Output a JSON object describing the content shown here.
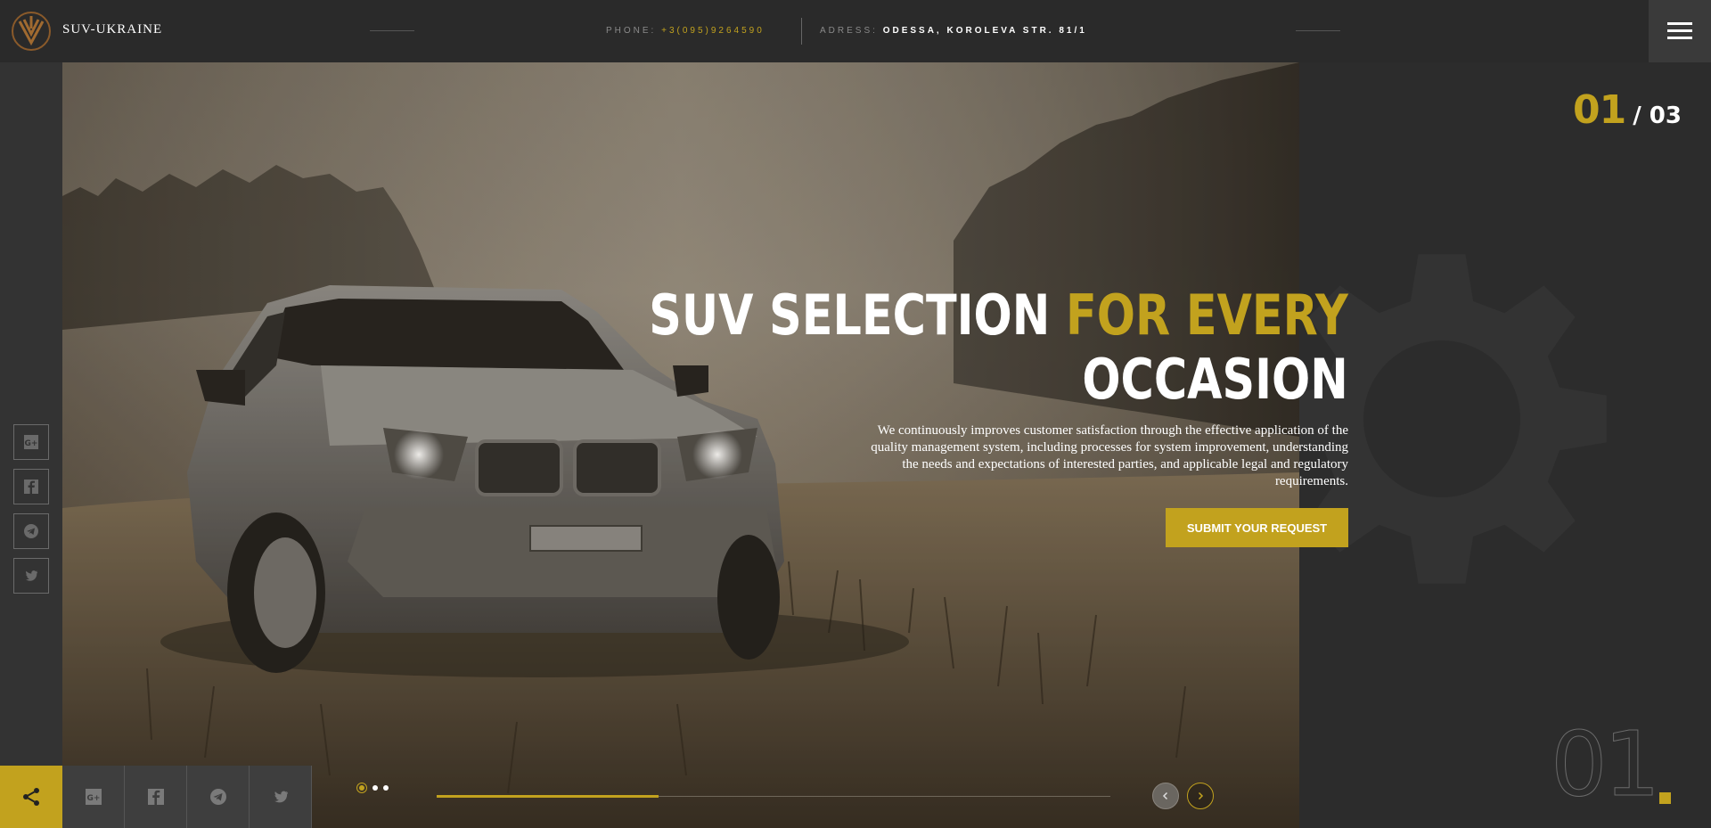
{
  "brand": {
    "name": "SUV-UKRAINE"
  },
  "header": {
    "phone_key": "PHONE:",
    "phone_value": "+3(095)9264590",
    "address_key": "ADRESS:",
    "address_value": "ODESSA, KOROLEVA STR. 81/1"
  },
  "slider": {
    "current": "01",
    "total": "/ 03",
    "big_number": "01",
    "progress_percent": 33
  },
  "hero": {
    "headline_white_1": "SUV SELECTION ",
    "headline_gold": "FOR EVERY",
    "headline_white_2": "OCCASION",
    "description": "We continuously improves customer satisfaction through the effective application of the quality management system, including processes for system improvement, understanding the needs and expectations of interested parties, and applicable legal and regulatory requirements.",
    "cta_label": "SUBMIT YOUR REQUEST"
  },
  "social": [
    "google-plus",
    "facebook",
    "telegram",
    "twitter"
  ],
  "colors": {
    "accent": "#c2a21e",
    "dark": "#2b2b2b"
  }
}
